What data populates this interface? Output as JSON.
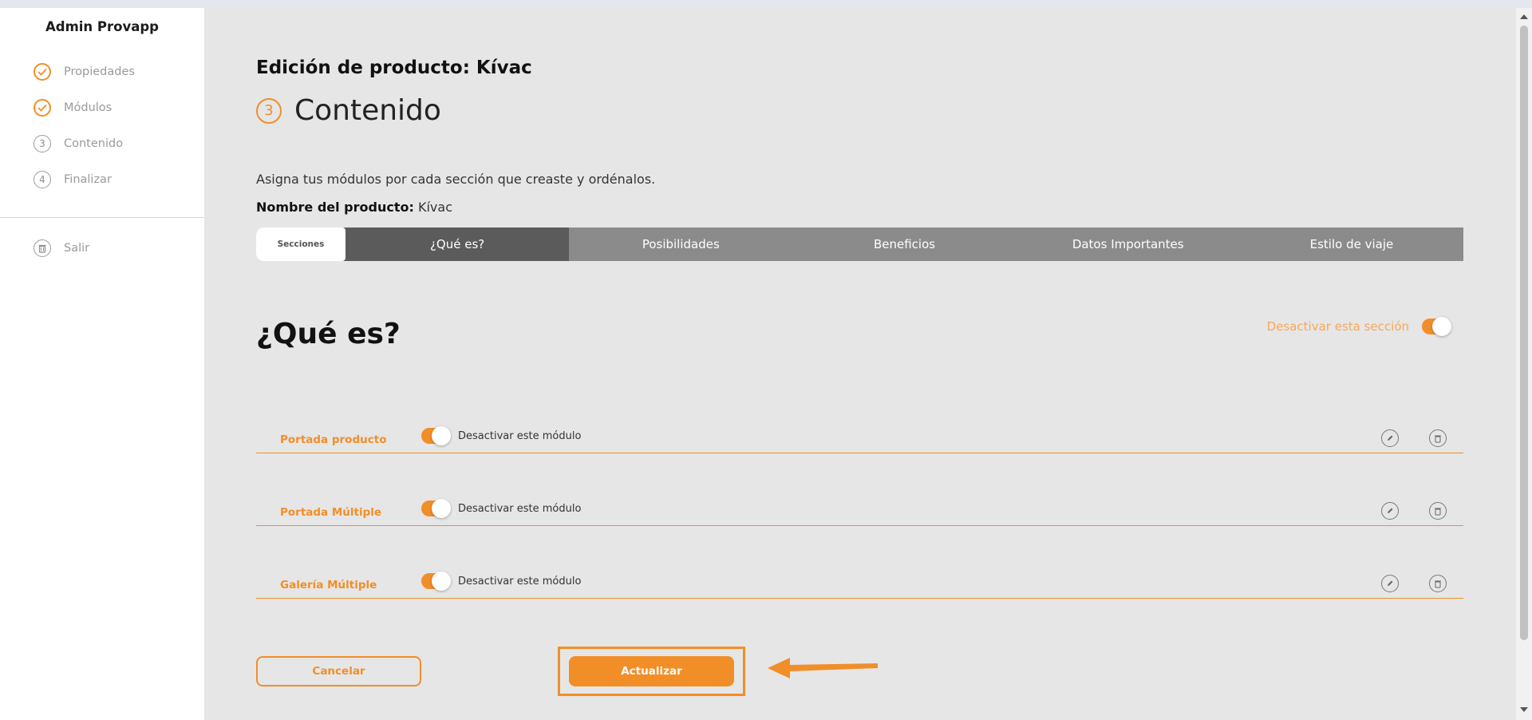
{
  "sidebar": {
    "brand": "Admin Provapp",
    "steps": [
      {
        "label": "Propiedades",
        "state": "done",
        "icon": "check-icon"
      },
      {
        "label": "Módulos",
        "state": "done",
        "icon": "check-icon"
      },
      {
        "label": "Contenido",
        "number": "3",
        "icon": "step-number-icon"
      },
      {
        "label": "Finalizar",
        "number": "4",
        "icon": "step-number-icon"
      }
    ],
    "logout": {
      "label": "Salir",
      "icon": "trash-icon"
    }
  },
  "header": {
    "title": "Edición de producto: Kívac",
    "step_number": "3",
    "step_label": "Contenido"
  },
  "intro": "Asigna tus módulos por cada sección que creaste y ordénalos.",
  "product": {
    "label": "Nombre del producto:",
    "value": "Kívac"
  },
  "tabs": {
    "lead": "Secciones",
    "items": [
      "¿Qué es?",
      "Posibilidades",
      "Beneficios",
      "Datos Importantes",
      "Estilo de viaje"
    ],
    "active": "¿Qué es?"
  },
  "section": {
    "title": "¿Qué es?",
    "toggle_label": "Desactivar esta sección",
    "toggle_on": true
  },
  "modules": [
    {
      "name": "Portada producto",
      "toggle_label": "Desactivar este módulo",
      "on": true
    },
    {
      "name": "Portada Múltiple",
      "toggle_label": "Desactivar este módulo",
      "on": true
    },
    {
      "name": "Galería Múltiple",
      "toggle_label": "Desactivar este módulo",
      "on": true
    }
  ],
  "actions": {
    "cancel": "Cancelar",
    "update": "Actualizar"
  },
  "colors": {
    "accent": "#f28e28",
    "tab_active": "#5b5b5b",
    "tab_inactive": "#8b8b8b",
    "background": "#e6e6e6"
  }
}
